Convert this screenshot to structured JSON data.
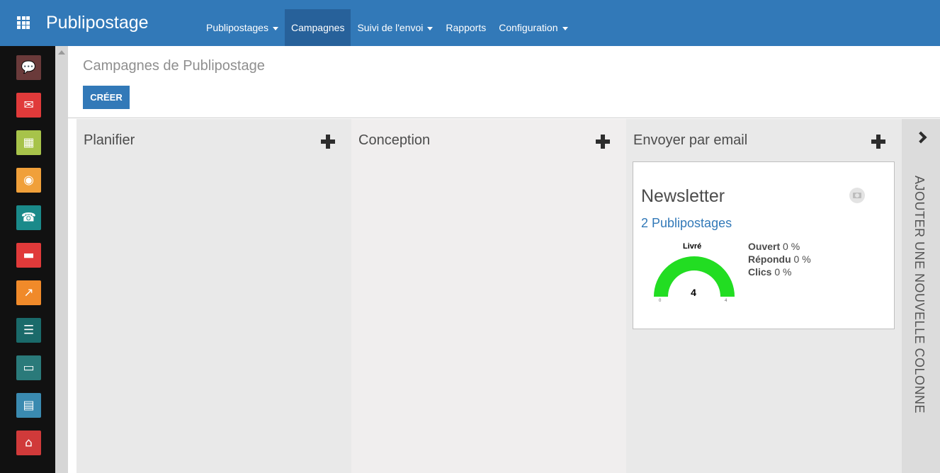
{
  "navbar": {
    "brand": "Publipostage",
    "menu": [
      {
        "label": "Publipostages",
        "dropdown": true
      },
      {
        "label": "Campagnes",
        "dropdown": false,
        "active": true
      },
      {
        "label": "Suivi de l'envoi",
        "dropdown": true
      },
      {
        "label": "Rapports",
        "dropdown": false
      },
      {
        "label": "Configuration",
        "dropdown": true
      }
    ]
  },
  "sidebar": {
    "apps": [
      {
        "icon": "discuss-chat-icon",
        "color": "#6a3a3a"
      },
      {
        "icon": "mail-envelope-icon",
        "color": "#e03a3a"
      },
      {
        "icon": "calendar-icon",
        "color": "#a7c34a"
      },
      {
        "icon": "location-pin-icon",
        "color": "#f0a03a"
      },
      {
        "icon": "contacts-phone-icon",
        "color": "#1a8a8a"
      },
      {
        "icon": "folder-icon",
        "color": "#e03a3a"
      },
      {
        "icon": "chart-trend-icon",
        "color": "#f08a2a"
      },
      {
        "icon": "newspaper-icon",
        "color": "#1a6a6a"
      },
      {
        "icon": "monitor-icon",
        "color": "#2a7a7a"
      },
      {
        "icon": "card-icon",
        "color": "#3a8ab0"
      },
      {
        "icon": "building-icon",
        "color": "#d03a3a"
      }
    ]
  },
  "control": {
    "breadcrumb": "Campagnes de Publipostage",
    "create_label": "CRÉER"
  },
  "columns": [
    {
      "title": "Planifier"
    },
    {
      "title": "Conception"
    },
    {
      "title": "Envoyer par email"
    }
  ],
  "card": {
    "title": "Newsletter",
    "subtitle": "2 Publipostages",
    "gauge": {
      "label": "Livré",
      "value": "4",
      "min": "0",
      "max": "4",
      "fraction": 1.0,
      "color": "#22dd22"
    },
    "stats": [
      {
        "label": "Ouvert",
        "value": "0 %"
      },
      {
        "label": "Répondu",
        "value": "0 %"
      },
      {
        "label": "Clics",
        "value": "0 %"
      }
    ]
  },
  "add_column": {
    "label": "AJOUTER UNE NOUVELLE COLONNE"
  }
}
